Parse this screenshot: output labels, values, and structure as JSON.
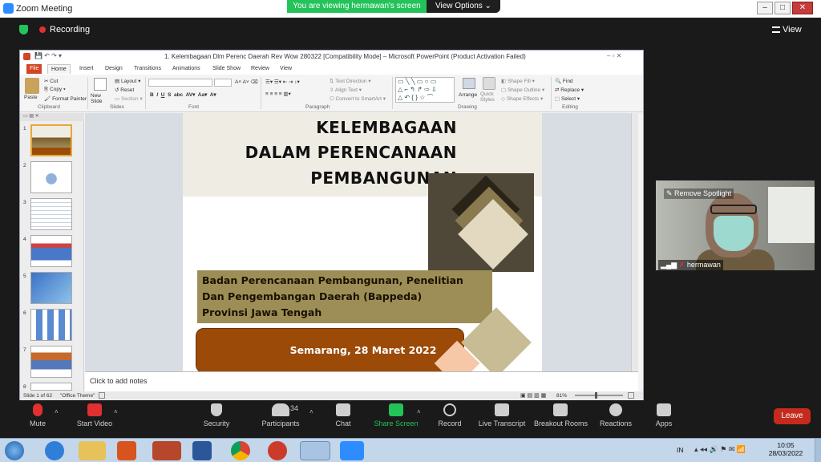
{
  "window": {
    "title": "Zoom Meeting"
  },
  "banner": {
    "viewing": "You are viewing hermawan's screen",
    "view_options": "View Options"
  },
  "zoom_top": {
    "recording": "Recording",
    "view": "View"
  },
  "ppt": {
    "title": "1. Kelembagaan Dlm Perenc Daerah Rev Wow 280322 [Compatibility Mode] – Microsoft PowerPoint (Product Activation Failed)",
    "tabs": [
      "File",
      "Home",
      "Insert",
      "Design",
      "Transitions",
      "Animations",
      "Slide Show",
      "Review",
      "View"
    ],
    "ribbon": {
      "clipboard": {
        "paste": "Paste",
        "cut": "Cut",
        "copy": "Copy",
        "format_painter": "Format Painter",
        "group": "Clipboard"
      },
      "slides": {
        "new_slide": "New Slide",
        "layout": "Layout",
        "reset": "Reset",
        "section": "Section",
        "group": "Slides"
      },
      "font": {
        "group": "Font"
      },
      "paragraph": {
        "text_direction": "Text Direction",
        "align_text": "Align Text",
        "convert_smartart": "Convert to SmartArt",
        "group": "Paragraph"
      },
      "drawing": {
        "arrange": "Arrange",
        "quick_styles": "Quick Styles",
        "shape_fill": "Shape Fill",
        "shape_outline": "Shape Outline",
        "shape_effects": "Shape Effects",
        "group": "Drawing"
      },
      "editing": {
        "find": "Find",
        "replace": "Replace",
        "select": "Select",
        "group": "Editing"
      }
    },
    "slide_numbers": [
      "1",
      "2",
      "3",
      "4",
      "5",
      "6",
      "7",
      "8"
    ],
    "slide": {
      "title_lines": [
        "KELEMBAGAAN",
        "DALAM PERENCANAAN",
        "PEMBANGUNAN"
      ],
      "subtitle_lines": [
        "Badan Perencanaan Pembangunan, Penelitian",
        "Dan Pengembangan Daerah (Bappeda)",
        "Provinsi Jawa Tengah"
      ],
      "date": "Semarang, 28 Maret 2022"
    },
    "notes_placeholder": "Click to add notes",
    "status": {
      "slide_of": "Slide 1 of 62",
      "theme": "\"Office Theme\"",
      "zoom": "81%"
    }
  },
  "video": {
    "spotlight": "Remove Spotlight",
    "name": "hermawan"
  },
  "toolbar": {
    "mute": "Mute",
    "start_video": "Start Video",
    "security": "Security",
    "participants": "Participants",
    "participant_count": "34",
    "chat": "Chat",
    "share_screen": "Share Screen",
    "record": "Record",
    "live_transcript": "Live Transcript",
    "breakout": "Breakout Rooms",
    "reactions": "Reactions",
    "apps": "Apps",
    "leave": "Leave"
  },
  "taskbar": {
    "lang": "IN",
    "time": "10:05",
    "date": "28/03/2022"
  },
  "colors": {
    "zoom_green": "#23c35a",
    "leave_red": "#c42b1c",
    "slide_brown": "#9b4a08",
    "slide_olive": "#9d8e57"
  }
}
